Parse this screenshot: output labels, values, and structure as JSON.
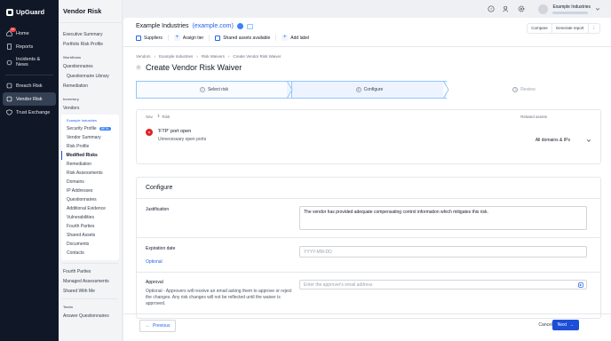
{
  "app": {
    "logo": "UpGuard"
  },
  "left_nav": [
    {
      "label": "Home",
      "icon": "home-icon",
      "badge": "11"
    },
    {
      "label": "Reports",
      "icon": "reports-icon"
    },
    {
      "label": "Incidents & News",
      "icon": "incidents-icon"
    },
    {
      "label": "Breach Risk",
      "icon": "breach-icon"
    },
    {
      "label": "Vendor Risk",
      "icon": "vendor-icon"
    },
    {
      "label": "Trust Exchange",
      "icon": "shield-icon"
    }
  ],
  "sub_nav": {
    "title": "Vendor Risk",
    "top_items": [
      "Executive Summary",
      "Portfolio Risk Profile"
    ],
    "workflows_label": "Workflows",
    "workflows": [
      "Questionnaires",
      "Questionnaire Library",
      "Remediation"
    ],
    "inventory_label": "Inventory",
    "vendors": "Vendors",
    "company": "Example Industries",
    "company_items": [
      "Security Profile",
      "Vendor Summary",
      "Risk Profile",
      "Modified Risks",
      "Remediation",
      "Risk Assessments",
      "Domains",
      "IP Addresses",
      "Questionnaires",
      "Additional Evidence",
      "Vulnerabilities",
      "Fourth Parties",
      "Shared Assets",
      "Documents",
      "Contacts"
    ],
    "beta": "BETA",
    "after_items": [
      "Fourth Parties",
      "Managed Assessments",
      "Shared With Me"
    ],
    "tasks_label": "Tasks",
    "tasks": [
      "Answer Questionnaires"
    ]
  },
  "topbar": {
    "user_name": "Example Industries"
  },
  "vendor": {
    "name": "Example Industries",
    "domain": "(example.com)",
    "actions": [
      "Suppliers",
      "Assign tier",
      "Shared assets available"
    ],
    "add_label": "Add label",
    "buttons": [
      "Compare",
      "Generate report",
      "⋮"
    ]
  },
  "breadcrumbs": [
    "Vendors",
    "›",
    "Example Industries",
    "›",
    "Risk Waivers",
    "›",
    "Create Vendor Risk Waiver"
  ],
  "page_title": "Create Vendor Risk Waiver",
  "steps": [
    {
      "label": "Select risk",
      "marker": "✓"
    },
    {
      "label": "Configure",
      "marker": "2"
    },
    {
      "label": "Review",
      "marker": "3"
    }
  ],
  "risk": {
    "col_sev": "Sev.",
    "col_risk": "Risk",
    "col_assets": "Related assets",
    "sev_badge": "H",
    "title": "'FTP' port open",
    "subtitle": "Unnecessary open ports",
    "assets": "All domains & IPs"
  },
  "configure": {
    "title": "Configure",
    "justification_label": "Justification",
    "justification_value": "The vendor has provided adequate compensating control information which mitigates this risk.",
    "expiration_label": "Expiration date",
    "expiration_sub": "Optional",
    "expiration_placeholder": "YYYY-MM-DD",
    "approval_label": "Approval",
    "approval_desc": "Optional - Approvers will receive an email asking them to approve or reject the changes. Any risk changes will not be reflected until the waiver is approved.",
    "approval_placeholder": "Enter the approver's email address"
  },
  "footer": {
    "previous": "Previous",
    "cancel": "Cancel",
    "next": "Next"
  }
}
